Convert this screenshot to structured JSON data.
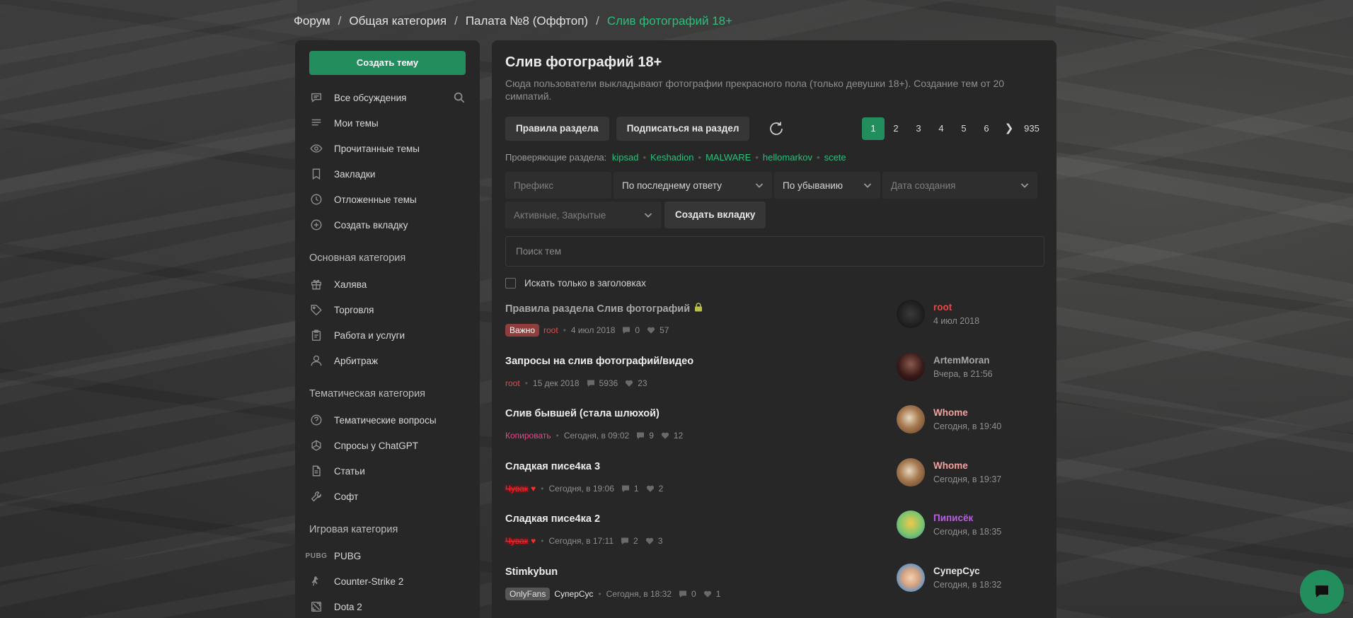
{
  "breadcrumb": {
    "items": [
      "Форум",
      "Общая категория",
      "Палата №8 (Оффтоп)"
    ],
    "separator": "/",
    "current": "Слив фотографий 18+"
  },
  "sidebar": {
    "create_topic_label": "Создать тему",
    "nav": [
      {
        "label": "Все обсуждения",
        "icon": "chat-icon"
      },
      {
        "label": "Мои темы",
        "icon": "list-icon"
      },
      {
        "label": "Прочитанные темы",
        "icon": "eye-icon"
      },
      {
        "label": "Закладки",
        "icon": "bookmark-icon"
      },
      {
        "label": "Отложенные темы",
        "icon": "clock-icon"
      },
      {
        "label": "Создать вкладку",
        "icon": "plus-circle-icon"
      }
    ],
    "sections": [
      {
        "title": "Основная категория",
        "items": [
          {
            "label": "Халява",
            "icon": "gift-icon"
          },
          {
            "label": "Торговля",
            "icon": "tag-icon"
          },
          {
            "label": "Работа и услуги",
            "icon": "clipboard-icon"
          },
          {
            "label": "Арбитраж",
            "icon": "user-icon"
          }
        ]
      },
      {
        "title": "Тематическая категория",
        "items": [
          {
            "label": "Тематические вопросы",
            "icon": "question-icon"
          },
          {
            "label": "Спросы у ChatGPT",
            "icon": "openai-icon"
          },
          {
            "label": "Статьи",
            "icon": "document-icon"
          },
          {
            "label": "Софт",
            "icon": "wrench-icon"
          }
        ]
      },
      {
        "title": "Игровая категория",
        "items": [
          {
            "label": "PUBG",
            "icon": "pubg-icon",
            "icon_text": "PUBG"
          },
          {
            "label": "Counter-Strike 2",
            "icon": "counter-strike-icon"
          },
          {
            "label": "Dota 2",
            "icon": "dota-icon"
          }
        ]
      }
    ]
  },
  "main": {
    "title": "Слив фотографий 18+",
    "description": "Сюда пользователи выкладывают фотографии прекрасного пола (только девушки 18+). Создание тем от 20 симпатий.",
    "buttons": {
      "rules": "Правила раздела",
      "subscribe": "Подписаться на раздел"
    },
    "pagination": {
      "pages": [
        "1",
        "2",
        "3",
        "4",
        "5",
        "6"
      ],
      "current": "1",
      "next": "❯",
      "last": "935"
    },
    "moderators_label": "Проверяющие раздела:",
    "moderators": [
      "kipsad",
      "Keshadion",
      "MALWARE",
      "hellomarkov",
      "scete"
    ],
    "filters": {
      "prefix_placeholder": "Префикс",
      "sort": "По последнему ответу",
      "order": "По убыванию",
      "date_placeholder": "Дата создания",
      "state": "Активные, Закрытые",
      "create_tab": "Создать вкладку"
    },
    "search_placeholder": "Поиск тем",
    "title_only_label": "Искать только в заголовках"
  },
  "threads": [
    {
      "title": "Правила раздела Слив фотографий",
      "sticky": true,
      "badge": "Важно",
      "author": "root",
      "date": "4 июл 2018",
      "replies": "0",
      "likes": "57",
      "last_user": "root",
      "last_date": "4 июл 2018"
    },
    {
      "title": "Запросы на слив фотографий/видео",
      "sticky": false,
      "author": "root",
      "date": "15 дек 2018",
      "replies": "5936",
      "likes": "23",
      "last_user": "ArtemMoran",
      "last_date": "Вчера, в 21:56"
    },
    {
      "title": "Слив бывшей (стала шлюхой)",
      "sticky": false,
      "author": "Копировать",
      "date": "Сегодня, в 09:02",
      "replies": "9",
      "likes": "12",
      "last_user": "Whome",
      "last_date": "Сегодня, в 19:40"
    },
    {
      "title": "Сладкая писе4ка 3",
      "sticky": false,
      "author": "Чувак",
      "date": "Сегодня, в 19:06",
      "replies": "1",
      "likes": "2",
      "last_user": "Whome",
      "last_date": "Сегодня, в 19:37"
    },
    {
      "title": "Сладкая писе4ка 2",
      "sticky": false,
      "author": "Чувак",
      "date": "Сегодня, в 17:11",
      "replies": "2",
      "likes": "3",
      "last_user": "Пиписёк",
      "last_date": "Сегодня, в 18:35"
    },
    {
      "title": "Stimkybun",
      "sticky": false,
      "badge": "OnlyFans",
      "author": "СуперСус",
      "date": "Сегодня, в 18:32",
      "replies": "0",
      "likes": "1",
      "last_user": "СуперСус",
      "last_date": "Сегодня, в 18:32"
    }
  ],
  "colors": {
    "accent": "#228e5d",
    "accent_text": "#2bbf7b",
    "panel": "#272727",
    "important_badge": "#8f3d3d",
    "root_red": "#e24b4b"
  }
}
